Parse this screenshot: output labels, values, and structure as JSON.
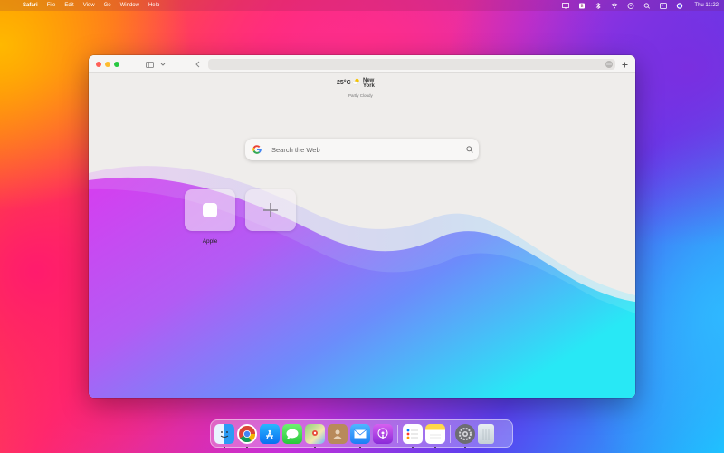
{
  "menubar": {
    "app": "Safari",
    "menus": [
      "File",
      "Edit",
      "View",
      "Go",
      "Window",
      "Help"
    ],
    "clock": "Thu 11:22"
  },
  "window": {
    "weather": {
      "temp": "25°C",
      "city": "New York",
      "condition": "Partly Cloudy"
    },
    "search": {
      "placeholder": "Search the Web"
    },
    "favorites": [
      {
        "label": "Apple"
      }
    ]
  },
  "dock": {
    "items": [
      "finder-icon",
      "chrome-icon",
      "app-store-icon",
      "messages-icon",
      "maps-icon",
      "contacts-icon",
      "mail-icon",
      "podcasts-icon",
      "reminders-icon",
      "notes-icon",
      "system-settings-icon",
      "trash-icon"
    ]
  },
  "colors": {
    "close": "#ff5f57",
    "minimize": "#febc2e",
    "maximize": "#28c840",
    "window_bg": "#efedeb"
  }
}
